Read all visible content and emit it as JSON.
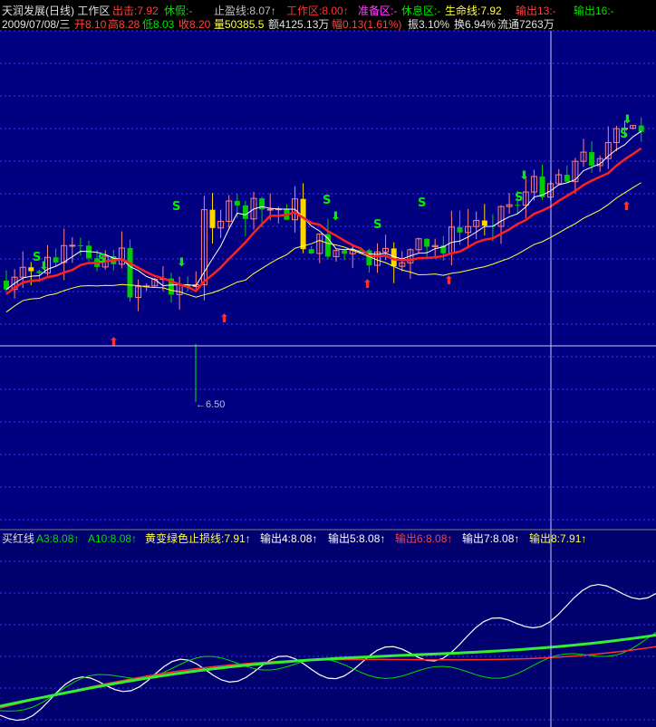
{
  "app_title": "天润发展(日线) 工作区",
  "header": {
    "items": [
      {
        "label": "出击:7.92",
        "color": "#ff4040"
      },
      {
        "label": "休假:-",
        "color": "#00e000"
      },
      {
        "label": "止盈线:8.07↑",
        "color": "#c0c0c0"
      },
      {
        "label": "工作区:8.00↑",
        "color": "#ff3030"
      },
      {
        "label": "准备区:-",
        "color": "#ff40ff"
      },
      {
        "label": "休息区:-",
        "color": "#00e000"
      },
      {
        "label": "生命线:7.92",
        "color": "#ffff40"
      },
      {
        "label": "输出13:-",
        "color": "#ff4040"
      },
      {
        "label": "输出16:-",
        "color": "#00e000"
      }
    ]
  },
  "quote": {
    "date": "2009/07/08/三",
    "open": "开8.10",
    "high": "高8.28",
    "low": "低8.03",
    "close": "收8.20",
    "volume": "量50385.5",
    "amount": "额4125.13万",
    "change": "幅0.13(1.61%)",
    "amplitude": "振3.10%",
    "turnover": "换6.94%",
    "float": "流通7263万"
  },
  "price_low_marker": "←6.50",
  "indicator": {
    "name": "买红线",
    "items": [
      {
        "label": "A3:8.08↑",
        "color": "#00e000"
      },
      {
        "label": "A10:8.08↑",
        "color": "#00e000"
      },
      {
        "label": "黄变绿色止损线:7.91↑",
        "color": "#ffff40"
      },
      {
        "label": "输出4:8.08↑",
        "color": "#ffffff"
      },
      {
        "label": "输出5:8.08↑",
        "color": "#ffffff"
      },
      {
        "label": "输出6:8.08↑",
        "color": "#ff4040"
      },
      {
        "label": "输出7:8.08↑",
        "color": "#ffffff"
      },
      {
        "label": "输出8:7.91↑",
        "color": "#ffff40"
      }
    ]
  },
  "colors": {
    "background": "#000000",
    "price_panel": "#000080",
    "indicator_panel": "#00006e",
    "grid": "#3a3aff",
    "up_candle": "#ffffff",
    "down_candle": "#00cc00",
    "ma_red": "#ff2020",
    "ma_yellow": "#ffff40",
    "ma_white": "#ffffff",
    "signal_s": "#00ee00",
    "crosshair": "#c8c8ff"
  }
}
